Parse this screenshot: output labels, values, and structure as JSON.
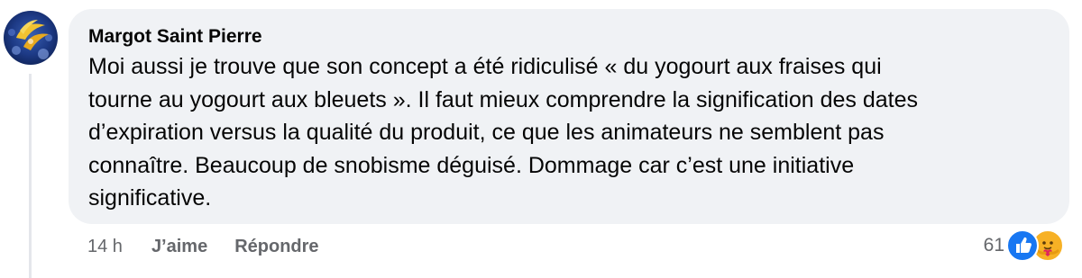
{
  "comment": {
    "author": "Margot Saint Pierre",
    "text_lines": [
      "Moi aussi je trouve que son concept a été ridiculisé « du yogourt aux fraises qui",
      "tourne au yogourt aux bleuets ». Il faut mieux comprendre la signification des dates",
      "d’expiration versus la qualité du produit, ce que les animateurs ne semblent pas",
      "connaître. Beaucoup de snobisme déguisé. Dommage car c’est une initiative",
      "significative."
    ],
    "timestamp": "14 h",
    "like_label": "J’aime",
    "reply_label": "Répondre",
    "reaction_count": "61",
    "reaction_icons": [
      "like-icon",
      "care-icon"
    ]
  },
  "colors": {
    "bubble": "#f0f2f5",
    "text": "#050505",
    "secondary_text": "#65676b",
    "like_blue": "#1877f2",
    "care_yellow": "#f7b125"
  }
}
